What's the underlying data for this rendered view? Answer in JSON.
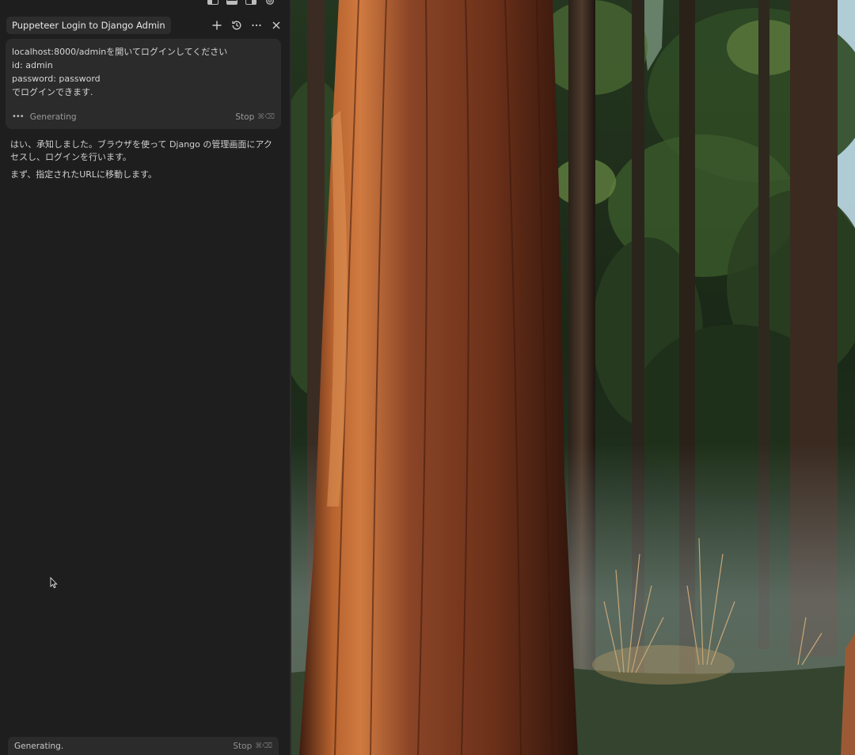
{
  "panel": {
    "tab_title": "Puppeteer Login to Django Admin",
    "icons": {
      "new": "plus-icon",
      "history": "history-icon",
      "more": "more-icon",
      "close": "close-icon",
      "settings": "gear-icon"
    },
    "prompt": {
      "text": "localhost:8000/adminを開いてログインしてください\nid: admin\npassword: password\nでログインできます.",
      "status": "Generating",
      "stop_label": "Stop",
      "stop_shortcut": "⌘⌫"
    },
    "response": {
      "paragraphs": [
        "はい、承知しました。ブラウザを使って Django の管理画面にアクセスし、ログインを行います。",
        "まず、指定されたURLに移動します。"
      ]
    },
    "status_bar": {
      "text": "Generating.",
      "stop_label": "Stop",
      "stop_shortcut": "⌘⌫"
    }
  },
  "scene": {
    "colors": {
      "sky": "#c9e6f5",
      "foliage_dark": "#1c2b18",
      "foliage_light": "#4f6e35",
      "trunk": "#7a3a22",
      "trunk_highlight": "#c9713d",
      "ground": "#35442f",
      "mist": "#9aa9a6"
    }
  }
}
